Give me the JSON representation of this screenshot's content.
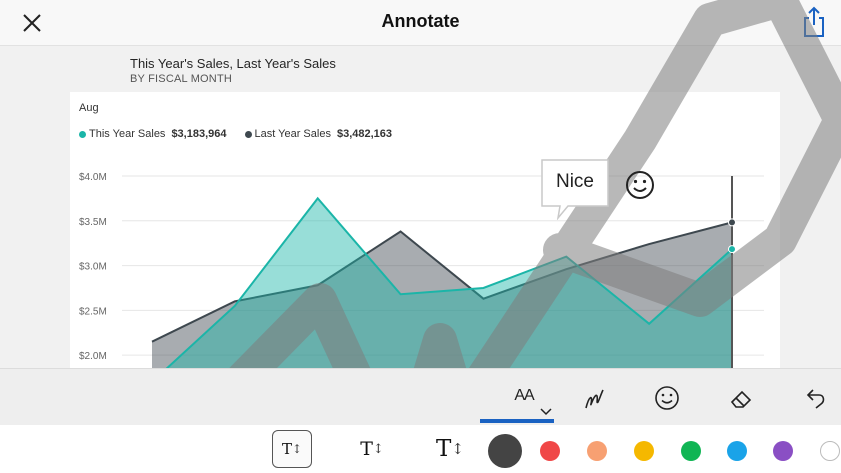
{
  "header": {
    "title": "Annotate",
    "close_icon": "close-icon",
    "share_icon": "share-icon"
  },
  "visual": {
    "title": "This Year's Sales, Last Year's Sales",
    "subtitle": "BY FISCAL MONTH",
    "period_label": "Aug",
    "legend": [
      {
        "name": "This Year Sales",
        "value": "$3,183,964",
        "color": "#1bb5a8"
      },
      {
        "name": "Last Year Sales",
        "value": "$3,482,163",
        "color": "#3e484f"
      }
    ]
  },
  "chart_data": {
    "type": "area",
    "y_tick_labels": [
      "$4.0M",
      "$3.5M",
      "$3.0M",
      "$2.5M",
      "$2.0M"
    ],
    "ylim": [
      1700000,
      4000000
    ],
    "series": [
      {
        "name": "This Year Sales",
        "color": "#1bb5a8",
        "values": [
          1700000,
          2550000,
          3750000,
          2680000,
          2750000,
          3100000,
          2350000,
          3183964
        ]
      },
      {
        "name": "Last Year Sales",
        "color": "#3e484f",
        "values": [
          2150000,
          2600000,
          2780000,
          3380000,
          2630000,
          2960000,
          3240000,
          3482163
        ]
      }
    ]
  },
  "annotations": {
    "callout_text": "Nice",
    "emoji_icon": "smiley-icon"
  },
  "toolbar": {
    "tools": [
      {
        "name": "text-tool",
        "icon": "text-size-icon",
        "label": "AA",
        "selected": true
      },
      {
        "name": "pen-tool",
        "icon": "pen-scribble-icon",
        "selected": false
      },
      {
        "name": "emoji-tool",
        "icon": "smiley-icon",
        "selected": false
      },
      {
        "name": "eraser-tool",
        "icon": "eraser-icon",
        "selected": false
      },
      {
        "name": "undo-tool",
        "icon": "undo-icon",
        "selected": false
      }
    ],
    "text_tool_label": "AA"
  },
  "palette": {
    "sizes": [
      {
        "label": "T",
        "selected": true
      },
      {
        "label": "T",
        "selected": false
      },
      {
        "label": "T",
        "selected": false
      }
    ],
    "colors": [
      "#444444",
      "#f04747",
      "#f7a072",
      "#f5b800",
      "#10b554",
      "#1aa3e8",
      "#8a4fc4",
      "#ffffff"
    ],
    "selected_color": "#444444"
  }
}
